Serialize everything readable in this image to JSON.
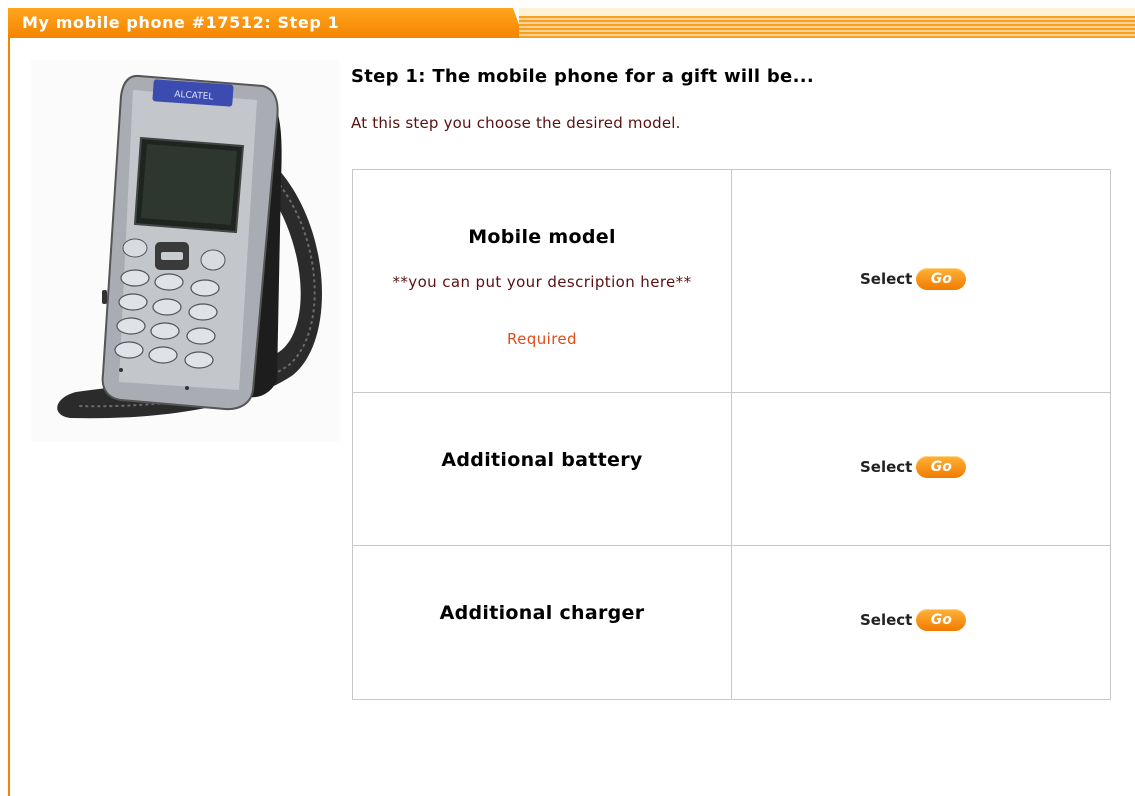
{
  "header": {
    "title": "My mobile phone #17512: Step 1"
  },
  "product": {
    "image_icon": "mobile-phone-photo",
    "brand_text": "ALCATEL"
  },
  "step": {
    "heading": "Step 1: The mobile phone for a gift will be...",
    "description": "At this step you choose the desired model."
  },
  "options": [
    {
      "title": "Mobile model",
      "description": "**you can put your description here**",
      "required": "Required",
      "select_label": "Select",
      "go_label": "Go"
    },
    {
      "title": "Additional battery",
      "select_label": "Select",
      "go_label": "Go"
    },
    {
      "title": "Additional charger",
      "select_label": "Select",
      "go_label": "Go"
    }
  ],
  "colors": {
    "accent": "#f58400",
    "description_text": "#5a1010",
    "required_text": "#e04b1a"
  }
}
